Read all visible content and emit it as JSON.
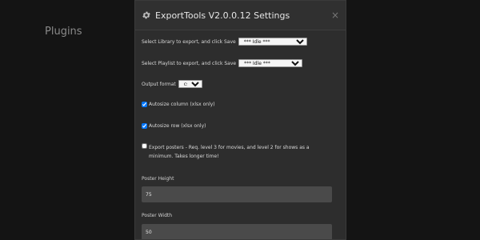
{
  "page": {
    "title": "Plugins"
  },
  "modal": {
    "title": "ExportTools V2.0.0.12 Settings",
    "close_glyph": "×",
    "library": {
      "label": "Select Library to export, and click Save",
      "selected": "*** Idle ***"
    },
    "playlist": {
      "label": "Select Playlist to export, and click Save",
      "selected": "*** Idle ***"
    },
    "output_format": {
      "label": "Output format",
      "selected": "csv"
    },
    "autosize_column": {
      "label": "Autosize column (xlsx only)",
      "checked": true
    },
    "autosize_row": {
      "label": "Autosize row (xlsx only)",
      "checked": true
    },
    "export_posters": {
      "label": "Export posters - Req. level 3 for movies, and level 2 for shows as a minimum. Takes longer time!",
      "checked": false
    },
    "poster_height": {
      "label": "Poster Height",
      "value": "75"
    },
    "poster_width": {
      "label": "Poster Width",
      "value": "50"
    }
  }
}
